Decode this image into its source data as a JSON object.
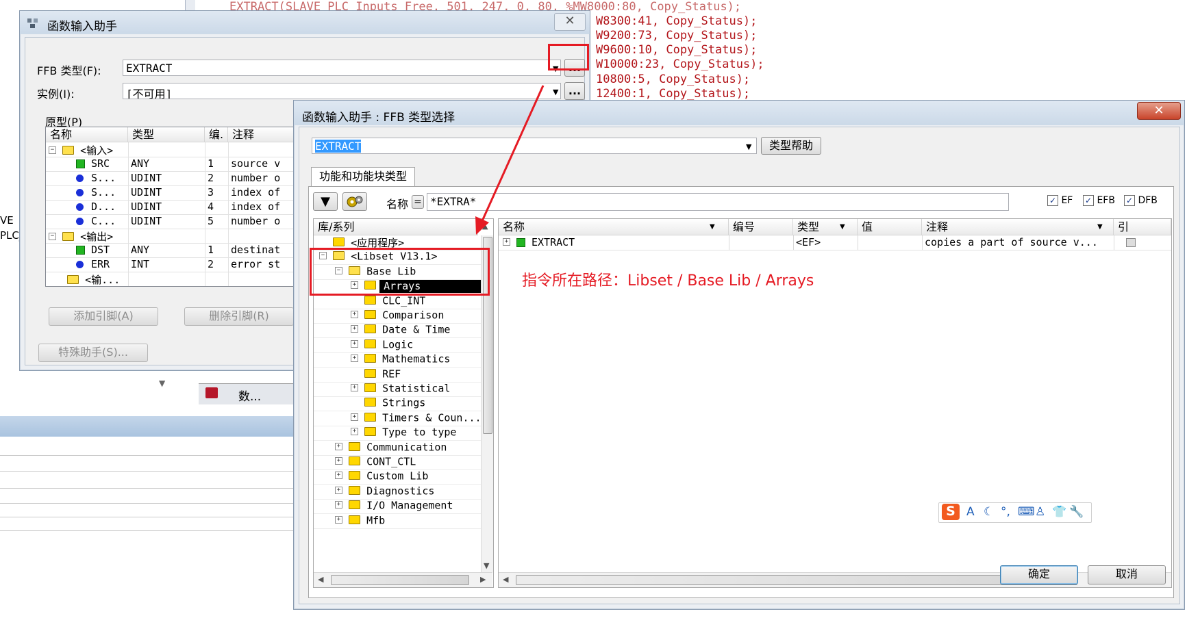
{
  "background": {
    "code_lines": [
      "EXTRACT(SLAVE_PLC_Inputs_Free, 501, 247, 0, 80, %MW8000:80, Copy_Status);",
      "W8300:41, Copy_Status);",
      "W9200:73, Copy_Status);",
      "W9600:10, Copy_Status);",
      "W10000:23, Copy_Status);",
      "10800:5, Copy_Status);",
      "12400:1, Copy_Status);"
    ],
    "left_text_1": "VE",
    "left_text_2": "PLC_",
    "tab_label": "数..."
  },
  "assistant": {
    "title": "函数输入助手",
    "close_glyph": "✕",
    "ffb_type_label": "FFB 类型(F):",
    "ffb_type_value": "EXTRACT",
    "browse_label": "...",
    "instance_label": "实例(I):",
    "instance_value": "[不可用]",
    "prototype_label": "原型(P)",
    "columns": [
      "名称",
      "类型",
      "编.",
      "注释"
    ],
    "rows": [
      {
        "kind": "group",
        "name": "<输入>"
      },
      {
        "kind": "pin",
        "icon": "green",
        "name": "SRC",
        "type": "ANY",
        "no": "1",
        "comment": "source v"
      },
      {
        "kind": "pin",
        "icon": "blue",
        "name": "S...",
        "type": "UDINT",
        "no": "2",
        "comment": "number o"
      },
      {
        "kind": "pin",
        "icon": "blue",
        "name": "S...",
        "type": "UDINT",
        "no": "3",
        "comment": "index of"
      },
      {
        "kind": "pin",
        "icon": "blue",
        "name": "D...",
        "type": "UDINT",
        "no": "4",
        "comment": "index of"
      },
      {
        "kind": "pin",
        "icon": "blue",
        "name": "C...",
        "type": "UDINT",
        "no": "5",
        "comment": "number o"
      },
      {
        "kind": "group",
        "name": "<输出>"
      },
      {
        "kind": "pin",
        "icon": "green",
        "name": "DST",
        "type": "ANY",
        "no": "1",
        "comment": "destinat"
      },
      {
        "kind": "pin",
        "icon": "blue",
        "name": "ERR",
        "type": "INT",
        "no": "2",
        "comment": "error st"
      },
      {
        "kind": "group2",
        "name": "<输..."
      }
    ],
    "add_pin": "添加引脚(A)",
    "remove_pin": "删除引脚(R)",
    "special_assistant": "特殊助手(S)..."
  },
  "selector": {
    "title": "函数输入助手 : FFB 类型选择",
    "close_glyph": "✕",
    "type_value": "EXTRACT",
    "type_help": "类型帮助",
    "tab_label": "功能和功能块类型",
    "name_label": "名称",
    "equals_glyph": "=",
    "filter_value": "*EXTRA*",
    "checkboxes": [
      {
        "label": "EF",
        "checked": true
      },
      {
        "label": "EFB",
        "checked": true
      },
      {
        "label": "DFB",
        "checked": true
      }
    ],
    "tree_header": "库/系列",
    "tree": [
      {
        "label": "<应用程序>",
        "indent": 0,
        "expander": "none",
        "open": false
      },
      {
        "label": "<Libset V13.1>",
        "indent": 0,
        "expander": "minus",
        "open": true
      },
      {
        "label": "Base Lib",
        "indent": 1,
        "expander": "minus",
        "open": true
      },
      {
        "label": "Arrays",
        "indent": 2,
        "expander": "plus",
        "selected": true
      },
      {
        "label": "CLC_INT",
        "indent": 2,
        "expander": "none"
      },
      {
        "label": "Comparison",
        "indent": 2,
        "expander": "plus"
      },
      {
        "label": "Date & Time",
        "indent": 2,
        "expander": "plus"
      },
      {
        "label": "Logic",
        "indent": 2,
        "expander": "plus"
      },
      {
        "label": "Mathematics",
        "indent": 2,
        "expander": "plus"
      },
      {
        "label": "REF",
        "indent": 2,
        "expander": "none"
      },
      {
        "label": "Statistical",
        "indent": 2,
        "expander": "plus"
      },
      {
        "label": "Strings",
        "indent": 2,
        "expander": "none"
      },
      {
        "label": "Timers & Coun...",
        "indent": 2,
        "expander": "plus"
      },
      {
        "label": "Type to type",
        "indent": 2,
        "expander": "plus"
      },
      {
        "label": "Communication",
        "indent": 1,
        "expander": "plus"
      },
      {
        "label": "CONT_CTL",
        "indent": 1,
        "expander": "plus"
      },
      {
        "label": "Custom Lib",
        "indent": 1,
        "expander": "plus"
      },
      {
        "label": "Diagnostics",
        "indent": 1,
        "expander": "plus"
      },
      {
        "label": "I/O Management",
        "indent": 1,
        "expander": "plus"
      },
      {
        "label": "Mfb",
        "indent": 1,
        "expander": "plus"
      }
    ],
    "list_columns": [
      "名称",
      "编号",
      "类型",
      "值",
      "注释",
      "引"
    ],
    "list_rows": [
      {
        "name": "EXTRACT",
        "no": "",
        "type": "<EF>",
        "value": "",
        "comment": "copies a part of source v..."
      }
    ],
    "ok": "确定",
    "cancel": "取消"
  },
  "annotation": {
    "text": "指令所在路径：Libset / Base Lib / Arrays",
    "color": "#e51b24"
  },
  "ime_bar": {
    "logo": "S",
    "icons": [
      "A",
      "☾",
      "°,",
      "⌨",
      "♙",
      "👕",
      "🔧"
    ]
  }
}
